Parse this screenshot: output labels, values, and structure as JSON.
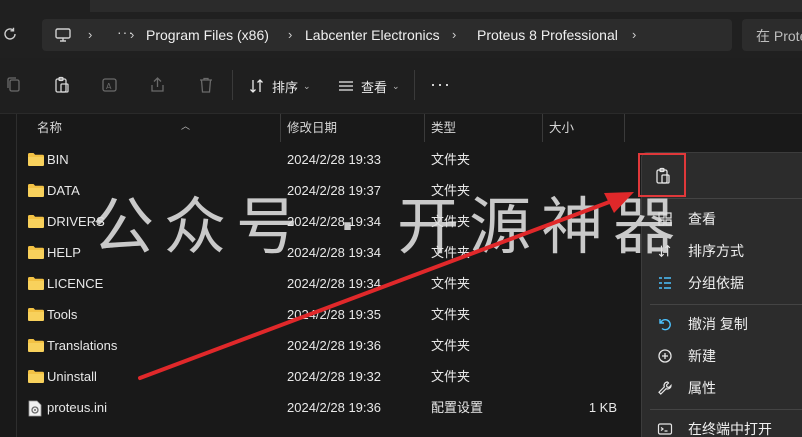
{
  "address": {
    "crumbs": [
      "Program Files (x86)",
      "Labcenter Electronics",
      "Proteus 8 Professional"
    ],
    "more": "···",
    "search_placeholder": "在 Proteus"
  },
  "toolbar": {
    "sort_label": "排序",
    "view_label": "查看",
    "more_label": "···"
  },
  "columns": {
    "name": "名称",
    "date": "修改日期",
    "type": "类型",
    "size": "大小"
  },
  "files": [
    {
      "name": "BIN",
      "date": "2024/2/28 19:33",
      "type": "文件夹",
      "size": "",
      "kind": "folder"
    },
    {
      "name": "DATA",
      "date": "2024/2/28 19:37",
      "type": "文件夹",
      "size": "",
      "kind": "folder"
    },
    {
      "name": "DRIVERS",
      "date": "2024/2/28 19:34",
      "type": "文件夹",
      "size": "",
      "kind": "folder"
    },
    {
      "name": "HELP",
      "date": "2024/2/28 19:34",
      "type": "文件夹",
      "size": "",
      "kind": "folder"
    },
    {
      "name": "LICENCE",
      "date": "2024/2/28 19:34",
      "type": "文件夹",
      "size": "",
      "kind": "folder"
    },
    {
      "name": "Tools",
      "date": "2024/2/28 19:35",
      "type": "文件夹",
      "size": "",
      "kind": "folder"
    },
    {
      "name": "Translations",
      "date": "2024/2/28 19:36",
      "type": "文件夹",
      "size": "",
      "kind": "folder"
    },
    {
      "name": "Uninstall",
      "date": "2024/2/28 19:32",
      "type": "文件夹",
      "size": "",
      "kind": "folder"
    },
    {
      "name": "proteus.ini",
      "date": "2024/2/28 19:36",
      "type": "配置设置",
      "size": "1 KB",
      "kind": "ini"
    }
  ],
  "context_menu": {
    "view": "查看",
    "sort_by": "排序方式",
    "group_by": "分组依据",
    "undo_copy": "撤消 复制",
    "new": "新建",
    "properties": "属性",
    "open_terminal": "在终端中打开"
  },
  "watermark": "公众号 · 开源神器",
  "colors": {
    "folder": "#f3c244",
    "accent": "#4cc2ff",
    "highlight_box": "#e0383a",
    "arrow": "#e0282a"
  }
}
